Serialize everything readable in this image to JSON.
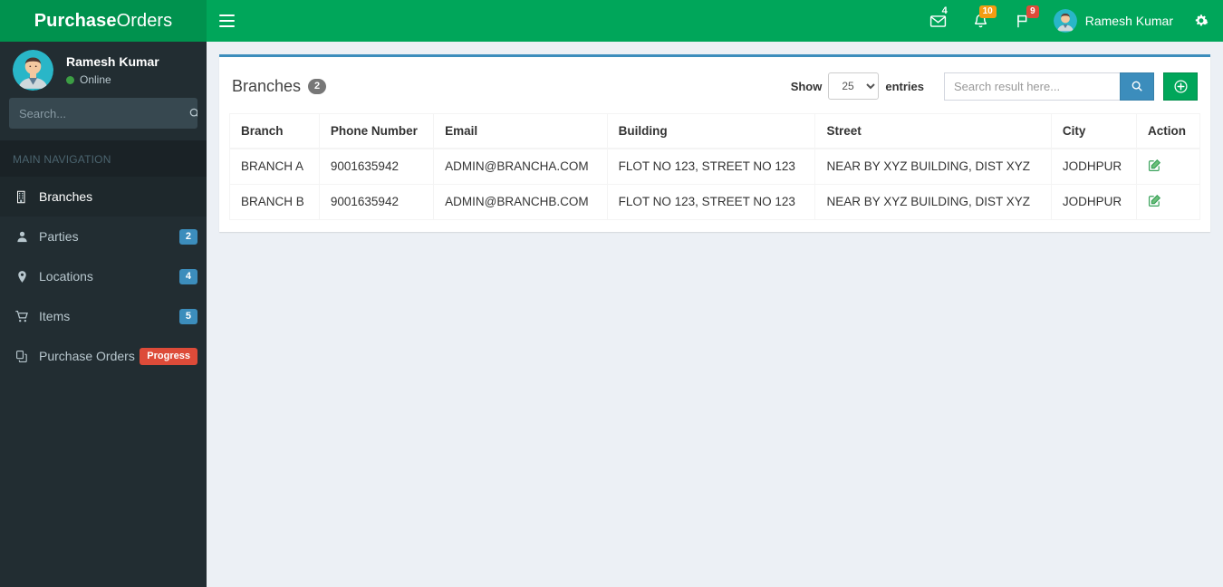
{
  "header": {
    "logo_bold": "Purchase",
    "logo_light": " Orders",
    "toggle_name": "sidebar-toggle",
    "messages_badge": "4",
    "notifications_badge": "10",
    "tasks_badge": "9",
    "user_name": "Ramesh Kumar"
  },
  "sidebar": {
    "user": {
      "name": "Ramesh Kumar",
      "status": "Online"
    },
    "search_placeholder": "Search...",
    "nav_header": "MAIN NAVIGATION",
    "items": [
      {
        "label": "Branches",
        "badge": "",
        "icon": "building-icon",
        "active": true
      },
      {
        "label": "Parties",
        "badge": "2",
        "icon": "user-icon",
        "active": false
      },
      {
        "label": "Locations",
        "badge": "4",
        "icon": "map-marker-icon",
        "active": false
      },
      {
        "label": "Items",
        "badge": "5",
        "icon": "shopping-cart-icon",
        "active": false
      },
      {
        "label": "Purchase Orders",
        "badge": "Progress",
        "icon": "copy-icon",
        "active": false
      }
    ]
  },
  "main": {
    "box_title": "Branches",
    "box_count": "2",
    "show_label": "Show",
    "entries_label": "entries",
    "entries_selected": "25",
    "entries_options": [
      "25"
    ],
    "search_placeholder": "Search result here...",
    "search_value": "",
    "table": {
      "columns": [
        "Branch",
        "Phone Number",
        "Email",
        "Building",
        "Street",
        "City",
        "Action"
      ],
      "rows": [
        {
          "branch": "BRANCH A",
          "phone": "9001635942",
          "email": "ADMIN@BRANCHA.COM",
          "building": "FLOT NO 123, STREET NO 123",
          "street": "NEAR BY XYZ BUILDING, DIST XYZ",
          "city": "JODHPUR"
        },
        {
          "branch": "BRANCH B",
          "phone": "9001635942",
          "email": "ADMIN@BRANCHB.COM",
          "building": "FLOT NO 123, STREET NO 123",
          "street": "NEAR BY XYZ BUILDING, DIST XYZ",
          "city": "JODHPUR"
        }
      ]
    }
  },
  "colors": {
    "brand_green": "#00a65a",
    "logo_green": "#00924e",
    "sidebar_dark": "#222d32",
    "accent_blue": "#3c8dbc",
    "danger_red": "#dd4b39",
    "warning_orange": "#f39c12",
    "content_bg": "#ecf0f5"
  }
}
